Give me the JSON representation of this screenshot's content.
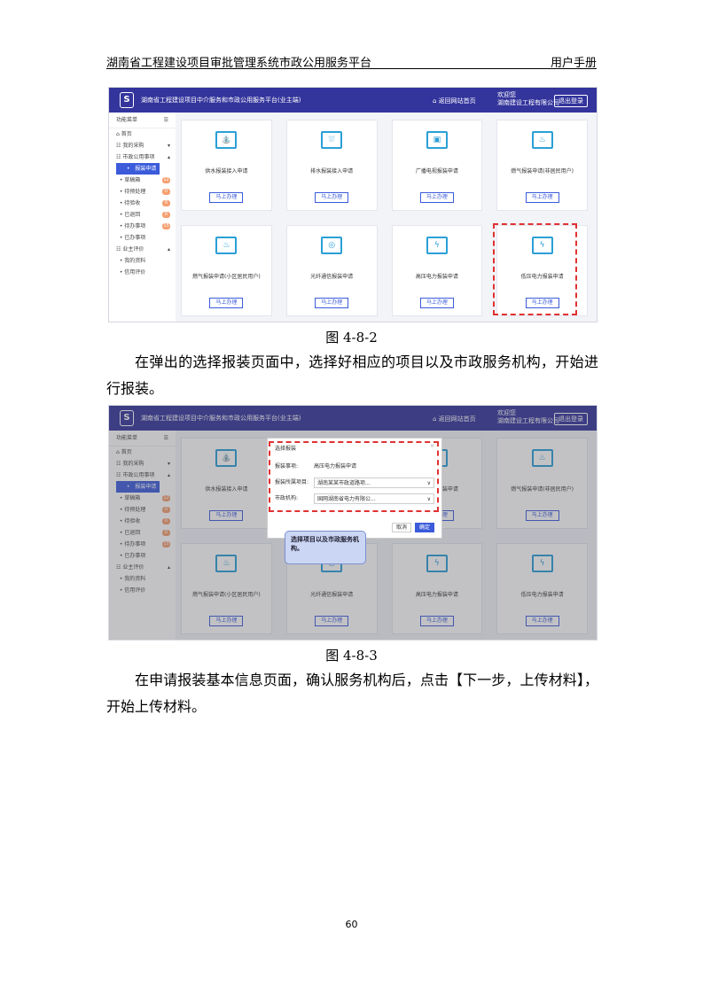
{
  "header": {
    "left": "湖南省工程建设项目审批管理系统市政公用服务平台",
    "right": "用户手册"
  },
  "app": {
    "logo": "S",
    "title": "湖南省工程建设项目中介服务和市政公用服务平台(业主端)",
    "home": "返回网站首页",
    "user_line1": "欢迎您",
    "user_line2": "湖南建设工程有限公司",
    "logout": "退出登录",
    "side_header": "功能菜单",
    "menu_glyph": "☰"
  },
  "sidebar": {
    "items": [
      {
        "label": "首页",
        "icon": "⌂",
        "arrow": "",
        "badge": ""
      },
      {
        "label": "我的采购",
        "icon": "☷",
        "arrow": "▾",
        "badge": ""
      },
      {
        "label": "市政公用事项",
        "icon": "☷",
        "arrow": "▴",
        "badge": ""
      },
      {
        "label": "报装申请",
        "icon": "•",
        "arrow": "",
        "badge": "",
        "active": true
      },
      {
        "label": "草稿箱",
        "icon": "•",
        "arrow": "",
        "badge": "12"
      },
      {
        "label": "待预处理",
        "icon": "•",
        "arrow": "",
        "badge": "0"
      },
      {
        "label": "待验收",
        "icon": "•",
        "arrow": "",
        "badge": "0"
      },
      {
        "label": "已退回",
        "icon": "•",
        "arrow": "",
        "badge": "0"
      },
      {
        "label": "待办事项",
        "icon": "•",
        "arrow": "",
        "badge": "15"
      },
      {
        "label": "已办事项",
        "icon": "•",
        "arrow": "",
        "badge": ""
      },
      {
        "label": "业主评价",
        "icon": "☷",
        "arrow": "▴",
        "badge": ""
      },
      {
        "label": "我的资料",
        "icon": "•",
        "arrow": "",
        "badge": ""
      },
      {
        "label": "信用评价",
        "icon": "•",
        "arrow": "",
        "badge": ""
      }
    ]
  },
  "cards": [
    {
      "name": "供水报装接入申请",
      "btn": "马上办理",
      "icon": "tap-icon",
      "glyph": "⛲"
    },
    {
      "name": "排水报装接入申请",
      "btn": "马上办理",
      "icon": "drain-icon",
      "glyph": "⛆"
    },
    {
      "name": "广播电视报装申请",
      "btn": "马上办理",
      "icon": "tv-icon",
      "glyph": "▣"
    },
    {
      "name": "燃气报装申请(非居民用户)",
      "btn": "马上办理",
      "icon": "gas-icon",
      "glyph": "♨"
    },
    {
      "name": "燃气报装申请(小区居民用户)",
      "btn": "马上办理",
      "icon": "gas-icon",
      "glyph": "♨"
    },
    {
      "name": "光纤通信报装申请",
      "btn": "马上办理",
      "icon": "fiber-icon",
      "glyph": "◎"
    },
    {
      "name": "高压电力报装申请",
      "btn": "马上办理",
      "icon": "power-icon",
      "glyph": "ϟ"
    },
    {
      "name": "低压电力报装申请",
      "btn": "马上办理",
      "icon": "power-icon",
      "glyph": "ϟ"
    }
  ],
  "caption1": "图 4-8-2",
  "para1": "在弹出的选择报装页面中，选择好相应的项目以及市政服务机构，开始进行报装。",
  "dialog": {
    "title": "选择报装",
    "close": "×",
    "rows": [
      {
        "label": "报装事项:",
        "value": "高压电力报装申请",
        "arrow": ""
      },
      {
        "label": "报装所属项目:",
        "value": "湖南某某市政道路项...",
        "arrow": "∨"
      },
      {
        "label": "市政机构:",
        "value": "国网湖南省电力有限公...",
        "arrow": "∨"
      }
    ],
    "cancel": "取消",
    "ok": "确定"
  },
  "callout": "选择项目以及市政服务机构。",
  "caption2": "图 4-8-3",
  "para2": "在申请报装基本信息页面，确认服务机构后，点击【下一步，上传材料】，开始上传材料。",
  "page_number": "60"
}
